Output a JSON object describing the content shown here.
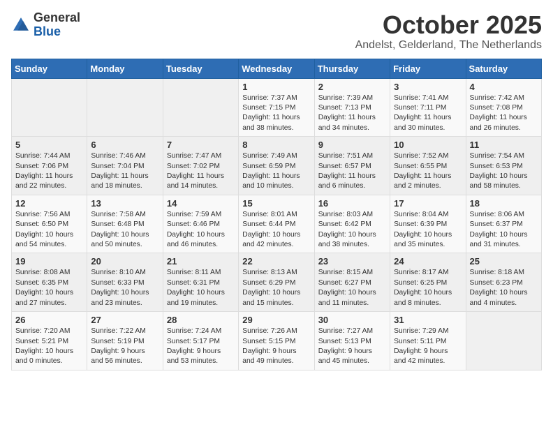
{
  "header": {
    "logo_general": "General",
    "logo_blue": "Blue",
    "month_title": "October 2025",
    "location": "Andelst, Gelderland, The Netherlands"
  },
  "weekdays": [
    "Sunday",
    "Monday",
    "Tuesday",
    "Wednesday",
    "Thursday",
    "Friday",
    "Saturday"
  ],
  "weeks": [
    [
      {
        "day": "",
        "info": ""
      },
      {
        "day": "",
        "info": ""
      },
      {
        "day": "",
        "info": ""
      },
      {
        "day": "1",
        "info": "Sunrise: 7:37 AM\nSunset: 7:15 PM\nDaylight: 11 hours\nand 38 minutes."
      },
      {
        "day": "2",
        "info": "Sunrise: 7:39 AM\nSunset: 7:13 PM\nDaylight: 11 hours\nand 34 minutes."
      },
      {
        "day": "3",
        "info": "Sunrise: 7:41 AM\nSunset: 7:11 PM\nDaylight: 11 hours\nand 30 minutes."
      },
      {
        "day": "4",
        "info": "Sunrise: 7:42 AM\nSunset: 7:08 PM\nDaylight: 11 hours\nand 26 minutes."
      }
    ],
    [
      {
        "day": "5",
        "info": "Sunrise: 7:44 AM\nSunset: 7:06 PM\nDaylight: 11 hours\nand 22 minutes."
      },
      {
        "day": "6",
        "info": "Sunrise: 7:46 AM\nSunset: 7:04 PM\nDaylight: 11 hours\nand 18 minutes."
      },
      {
        "day": "7",
        "info": "Sunrise: 7:47 AM\nSunset: 7:02 PM\nDaylight: 11 hours\nand 14 minutes."
      },
      {
        "day": "8",
        "info": "Sunrise: 7:49 AM\nSunset: 6:59 PM\nDaylight: 11 hours\nand 10 minutes."
      },
      {
        "day": "9",
        "info": "Sunrise: 7:51 AM\nSunset: 6:57 PM\nDaylight: 11 hours\nand 6 minutes."
      },
      {
        "day": "10",
        "info": "Sunrise: 7:52 AM\nSunset: 6:55 PM\nDaylight: 11 hours\nand 2 minutes."
      },
      {
        "day": "11",
        "info": "Sunrise: 7:54 AM\nSunset: 6:53 PM\nDaylight: 10 hours\nand 58 minutes."
      }
    ],
    [
      {
        "day": "12",
        "info": "Sunrise: 7:56 AM\nSunset: 6:50 PM\nDaylight: 10 hours\nand 54 minutes."
      },
      {
        "day": "13",
        "info": "Sunrise: 7:58 AM\nSunset: 6:48 PM\nDaylight: 10 hours\nand 50 minutes."
      },
      {
        "day": "14",
        "info": "Sunrise: 7:59 AM\nSunset: 6:46 PM\nDaylight: 10 hours\nand 46 minutes."
      },
      {
        "day": "15",
        "info": "Sunrise: 8:01 AM\nSunset: 6:44 PM\nDaylight: 10 hours\nand 42 minutes."
      },
      {
        "day": "16",
        "info": "Sunrise: 8:03 AM\nSunset: 6:42 PM\nDaylight: 10 hours\nand 38 minutes."
      },
      {
        "day": "17",
        "info": "Sunrise: 8:04 AM\nSunset: 6:39 PM\nDaylight: 10 hours\nand 35 minutes."
      },
      {
        "day": "18",
        "info": "Sunrise: 8:06 AM\nSunset: 6:37 PM\nDaylight: 10 hours\nand 31 minutes."
      }
    ],
    [
      {
        "day": "19",
        "info": "Sunrise: 8:08 AM\nSunset: 6:35 PM\nDaylight: 10 hours\nand 27 minutes."
      },
      {
        "day": "20",
        "info": "Sunrise: 8:10 AM\nSunset: 6:33 PM\nDaylight: 10 hours\nand 23 minutes."
      },
      {
        "day": "21",
        "info": "Sunrise: 8:11 AM\nSunset: 6:31 PM\nDaylight: 10 hours\nand 19 minutes."
      },
      {
        "day": "22",
        "info": "Sunrise: 8:13 AM\nSunset: 6:29 PM\nDaylight: 10 hours\nand 15 minutes."
      },
      {
        "day": "23",
        "info": "Sunrise: 8:15 AM\nSunset: 6:27 PM\nDaylight: 10 hours\nand 11 minutes."
      },
      {
        "day": "24",
        "info": "Sunrise: 8:17 AM\nSunset: 6:25 PM\nDaylight: 10 hours\nand 8 minutes."
      },
      {
        "day": "25",
        "info": "Sunrise: 8:18 AM\nSunset: 6:23 PM\nDaylight: 10 hours\nand 4 minutes."
      }
    ],
    [
      {
        "day": "26",
        "info": "Sunrise: 7:20 AM\nSunset: 5:21 PM\nDaylight: 10 hours\nand 0 minutes."
      },
      {
        "day": "27",
        "info": "Sunrise: 7:22 AM\nSunset: 5:19 PM\nDaylight: 9 hours\nand 56 minutes."
      },
      {
        "day": "28",
        "info": "Sunrise: 7:24 AM\nSunset: 5:17 PM\nDaylight: 9 hours\nand 53 minutes."
      },
      {
        "day": "29",
        "info": "Sunrise: 7:26 AM\nSunset: 5:15 PM\nDaylight: 9 hours\nand 49 minutes."
      },
      {
        "day": "30",
        "info": "Sunrise: 7:27 AM\nSunset: 5:13 PM\nDaylight: 9 hours\nand 45 minutes."
      },
      {
        "day": "31",
        "info": "Sunrise: 7:29 AM\nSunset: 5:11 PM\nDaylight: 9 hours\nand 42 minutes."
      },
      {
        "day": "",
        "info": ""
      }
    ]
  ]
}
